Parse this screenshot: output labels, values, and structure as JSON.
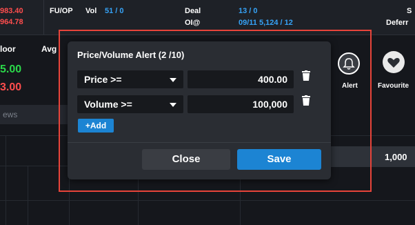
{
  "topbar": {
    "left_values": [
      "983.40",
      "964.78"
    ],
    "fuop_label": "FU/OP",
    "vol_label": "Vol",
    "vol_value": "51 / 0",
    "deal_label": "Deal",
    "deal_value": "13 / 0",
    "oi_label": "OI@",
    "oi_value": "09/11  5,124 / 12",
    "right_top": "S",
    "right_bottom": "Deferr"
  },
  "background": {
    "floor_label": "loor",
    "avg_label": "Avg",
    "green_value": "5.00",
    "red_value": "3.00",
    "news_label": "ews",
    "right_number": "1,000"
  },
  "actions": {
    "alert_label": "Alert",
    "favourite_label": "Favourite",
    "alert_icon": "bell-icon",
    "favourite_icon": "heart-icon"
  },
  "dialog": {
    "title": "Price/Volume Alert (2 /10)",
    "rows": [
      {
        "condition": "Price >=",
        "value": "400.00"
      },
      {
        "condition": "Volume >=",
        "value": "100,000"
      }
    ],
    "add_label": "+Add",
    "close_label": "Close",
    "save_label": "Save",
    "delete_icon": "trash-icon"
  },
  "colors": {
    "accent_blue": "#1c84d3",
    "highlight_red": "#e8443a",
    "up_green": "#2bd94a",
    "down_red": "#ff4d4d"
  }
}
